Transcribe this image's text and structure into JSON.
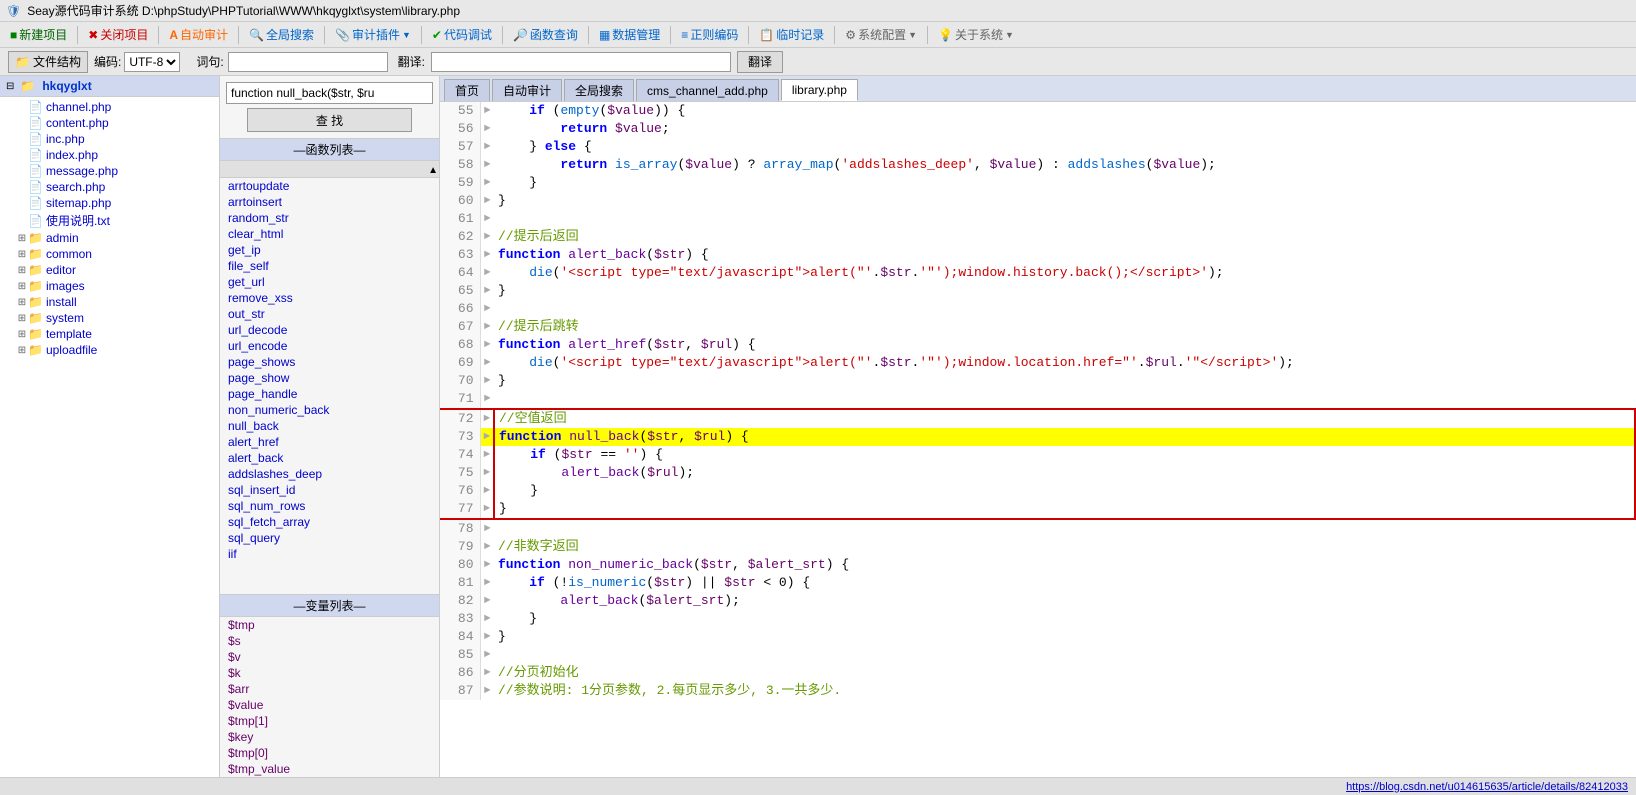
{
  "titlebar": {
    "title": "Seay源代码审计系统  D:\\phpStudy\\PHPTutorial\\WWW\\hkqyglxt\\system\\library.php",
    "icon": "🛡"
  },
  "menubar": {
    "items": [
      {
        "label": "新建项目",
        "icon": "📄",
        "class": "new-project"
      },
      {
        "label": "关闭项目",
        "icon": "✖",
        "class": "close-project"
      },
      {
        "label": "自动审计",
        "icon": "A",
        "class": "auto-audit"
      },
      {
        "label": "全局搜索",
        "icon": "🔍",
        "class": "global-search"
      },
      {
        "label": "审计插件",
        "icon": "🔌",
        "class": "audit-plugin"
      },
      {
        "label": "代码调试",
        "icon": "✔",
        "class": "code-debug"
      },
      {
        "label": "函数查询",
        "icon": "🔎",
        "class": "func-query"
      },
      {
        "label": "数据管理",
        "icon": "📊",
        "class": "data-mgmt"
      },
      {
        "label": "正则编码",
        "icon": "≡",
        "class": "regex-code"
      },
      {
        "label": "临时记录",
        "icon": "📋",
        "class": "temp-record"
      },
      {
        "label": "系统配置",
        "icon": "⚙",
        "class": "sys-config"
      },
      {
        "label": "关于系统",
        "icon": "💡",
        "class": "about-sys"
      }
    ]
  },
  "toolbar": {
    "file_structure": "文件结构",
    "encoding_label": "编码:",
    "encoding_value": "UTF-8",
    "query_label": "词句:",
    "query_placeholder": "",
    "translate_label": "翻译:",
    "translate_placeholder": "",
    "translate_btn": "翻译"
  },
  "filetree": {
    "root": "hkqyglxt",
    "files": [
      {
        "name": "channel.php",
        "type": "file",
        "indent": 1
      },
      {
        "name": "content.php",
        "type": "file",
        "indent": 1
      },
      {
        "name": "inc.php",
        "type": "file",
        "indent": 1
      },
      {
        "name": "index.php",
        "type": "file",
        "indent": 1
      },
      {
        "name": "message.php",
        "type": "file",
        "indent": 1
      },
      {
        "name": "search.php",
        "type": "file",
        "indent": 1
      },
      {
        "name": "sitemap.php",
        "type": "file",
        "indent": 1
      },
      {
        "name": "使用说明.txt",
        "type": "file",
        "indent": 1
      },
      {
        "name": "admin",
        "type": "folder",
        "indent": 1
      },
      {
        "name": "common",
        "type": "folder",
        "indent": 1
      },
      {
        "name": "editor",
        "type": "folder",
        "indent": 1
      },
      {
        "name": "images",
        "type": "folder",
        "indent": 1
      },
      {
        "name": "install",
        "type": "folder",
        "indent": 1
      },
      {
        "name": "system",
        "type": "folder",
        "indent": 1
      },
      {
        "name": "template",
        "type": "folder",
        "indent": 1
      },
      {
        "name": "uploadfile",
        "type": "folder",
        "indent": 1
      }
    ]
  },
  "middle": {
    "search_placeholder": "function null_back($str, $ru",
    "search_btn": "查 找",
    "func_list_header": "—函数列表—",
    "functions": [
      "arrtoupdate",
      "arrtoinsert",
      "random_str",
      "clear_html",
      "get_ip",
      "file_self",
      "get_url",
      "remove_xss",
      "out_str",
      "url_decode",
      "url_encode",
      "page_shows",
      "page_show",
      "page_handle",
      "non_numeric_back",
      "null_back",
      "alert_href",
      "alert_back",
      "addslashes_deep",
      "sql_insert_id",
      "sql_num_rows",
      "sql_fetch_array",
      "sql_query",
      "iif"
    ],
    "var_list_header": "—变量列表—",
    "variables": [
      "$tmp",
      "$s",
      "$v",
      "$k",
      "$arr",
      "$value",
      "$tmp[1]",
      "$key",
      "$tmp[0]",
      "$tmp_value"
    ]
  },
  "tabs": [
    {
      "label": "首页",
      "active": false
    },
    {
      "label": "自动审计",
      "active": false
    },
    {
      "label": "全局搜索",
      "active": false
    },
    {
      "label": "cms_channel_add.php",
      "active": false
    },
    {
      "label": "library.php",
      "active": true
    }
  ],
  "code": {
    "lines": [
      {
        "num": 55,
        "arrow": "►",
        "content": "    <span class='kw'>if</span> (<span class='builtin'>empty</span>(<span class='var'>$value</span>)) {"
      },
      {
        "num": 56,
        "arrow": "►",
        "content": "        <span class='kw'>return</span> <span class='var'>$value</span>;"
      },
      {
        "num": 57,
        "arrow": "►",
        "content": "    } <span class='kw'>else</span> {"
      },
      {
        "num": 58,
        "arrow": "►",
        "content": "        <span class='kw'>return</span> <span class='builtin'>is_array</span>(<span class='var'>$value</span>) ? <span class='builtin'>array_map</span>(<span class='str'>'addslashes_deep'</span>, <span class='var'>$value</span>) : <span class='builtin'>addslashes</span>(<span class='var'>$value</span>);"
      },
      {
        "num": 59,
        "arrow": "►",
        "content": "    }"
      },
      {
        "num": 60,
        "arrow": "►",
        "content": "}"
      },
      {
        "num": 61,
        "arrow": "►",
        "content": ""
      },
      {
        "num": 62,
        "arrow": "►",
        "content": "<span class='cmt'>//提示后返回</span>"
      },
      {
        "num": 63,
        "arrow": "►",
        "content": "<span class='kw'>function</span> <span class='fn-name'>alert_back</span>(<span class='var'>$str</span>) {"
      },
      {
        "num": 64,
        "arrow": "►",
        "content": "    <span class='builtin'>die</span>(<span class='str'>'&lt;script type=\"text/javascript\"&gt;alert(\"'</span>.<span class='var'>$str</span>.<span class='str'>'\"');window.history.back();&lt;/script&gt;'</span>);"
      },
      {
        "num": 65,
        "arrow": "►",
        "content": "}"
      },
      {
        "num": 66,
        "arrow": "►",
        "content": ""
      },
      {
        "num": 67,
        "arrow": "►",
        "content": "<span class='cmt'>//提示后跳转</span>"
      },
      {
        "num": 68,
        "arrow": "►",
        "content": "<span class='kw'>function</span> <span class='fn-name'>alert_href</span>(<span class='var'>$str</span>, <span class='var'>$rul</span>) {"
      },
      {
        "num": 69,
        "arrow": "►",
        "content": "    <span class='builtin'>die</span>(<span class='str'>'&lt;script type=\"text/javascript\"&gt;alert(\"'</span>.<span class='var'>$str</span>.<span class='str'>'\"');window.location.href=\"'</span>.<span class='var'>$rul</span>.<span class='str'>'\"&lt;/script&gt;'</span>);"
      },
      {
        "num": 70,
        "arrow": "►",
        "content": "}"
      },
      {
        "num": 71,
        "arrow": "►",
        "content": ""
      },
      {
        "num": 72,
        "arrow": "►",
        "content": "<span class='cmt'>//空值返回</span>"
      },
      {
        "num": 73,
        "arrow": "►",
        "content": "<span class='kw'>function</span> <span class='fn-name'>null_back</span>(<span class='var'>$str</span>, <span class='var'>$rul</span>) {",
        "highlight": true
      },
      {
        "num": 74,
        "arrow": "►",
        "content": "    <span class='kw'>if</span> (<span class='var'>$str</span> == <span class='str'>''</span>) {"
      },
      {
        "num": 75,
        "arrow": "►",
        "content": "        <span class='fn-name'>alert_back</span>(<span class='var'>$rul</span>);"
      },
      {
        "num": 76,
        "arrow": "►",
        "content": "    }"
      },
      {
        "num": 77,
        "arrow": "►",
        "content": "}"
      },
      {
        "num": 78,
        "arrow": "►",
        "content": ""
      },
      {
        "num": 79,
        "arrow": "►",
        "content": "<span class='cmt'>//非数字返回</span>"
      },
      {
        "num": 80,
        "arrow": "►",
        "content": "<span class='kw'>function</span> <span class='fn-name'>non_numeric_back</span>(<span class='var'>$str</span>, <span class='var'>$alert_srt</span>) {"
      },
      {
        "num": 81,
        "arrow": "►",
        "content": "    <span class='kw'>if</span> (!<span class='builtin'>is_numeric</span>(<span class='var'>$str</span>) || <span class='var'>$str</span> &lt; 0) {"
      },
      {
        "num": 82,
        "arrow": "►",
        "content": "        <span class='fn-name'>alert_back</span>(<span class='var'>$alert_srt</span>);"
      },
      {
        "num": 83,
        "arrow": "►",
        "content": "    }"
      },
      {
        "num": 84,
        "arrow": "►",
        "content": "}"
      },
      {
        "num": 85,
        "arrow": "►",
        "content": ""
      },
      {
        "num": 86,
        "arrow": "►",
        "content": "<span class='cmt'>//分页初始化</span>"
      },
      {
        "num": 87,
        "arrow": "►",
        "content": "<span class='cmt'>//参数说明: 1分页参数, 2.每页显示多少, 3.一共多少.</span>"
      }
    ]
  },
  "statusbar": {
    "url": "https://blog.csdn.net/u014615635/article/details/82412033"
  },
  "boxed_lines": {
    "start": 72,
    "end": 77
  }
}
